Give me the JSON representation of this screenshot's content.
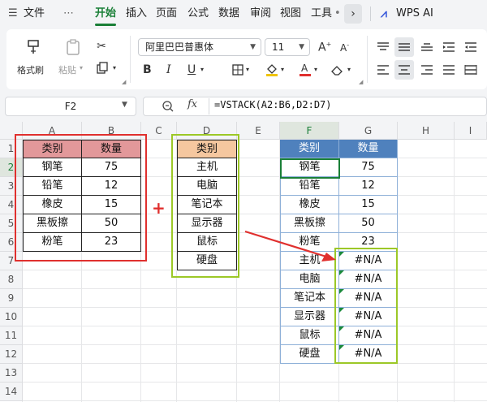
{
  "menu": {
    "file": "文件",
    "more": "⋯",
    "tabs": [
      "开始",
      "插入",
      "页面",
      "公式",
      "数据",
      "审阅",
      "视图",
      "工具"
    ],
    "active_tab": "开始",
    "wps_ai": "WPS AI"
  },
  "ribbon": {
    "format_painter": "格式刷",
    "paste": "粘贴",
    "font_name": "阿里巴巴普惠体",
    "font_size": "11",
    "bold": "B",
    "italic": "I",
    "underline": "U"
  },
  "formula_bar": {
    "cell_ref": "F2",
    "fx": "fx",
    "formula": "=VSTACK(A2:B6,D2:D7)"
  },
  "columns": [
    "A",
    "B",
    "C",
    "D",
    "E",
    "F",
    "G",
    "H",
    "I"
  ],
  "rows": [
    "1",
    "2",
    "3",
    "4",
    "5",
    "6",
    "7",
    "8",
    "9",
    "10",
    "11",
    "12",
    "13",
    "14"
  ],
  "table1": {
    "headers": [
      "类别",
      "数量"
    ],
    "rows": [
      [
        "钢笔",
        "75"
      ],
      [
        "铅笔",
        "12"
      ],
      [
        "橡皮",
        "15"
      ],
      [
        "黑板擦",
        "50"
      ],
      [
        "粉笔",
        "23"
      ]
    ]
  },
  "table2": {
    "header": "类别",
    "items": [
      "主机",
      "电脑",
      "笔记本",
      "显示器",
      "鼠标",
      "硬盘"
    ]
  },
  "plus_sign": "+",
  "result": {
    "headers": [
      "类别",
      "数量"
    ],
    "rows": [
      [
        "钢笔",
        "75"
      ],
      [
        "铅笔",
        "12"
      ],
      [
        "橡皮",
        "15"
      ],
      [
        "黑板擦",
        "50"
      ],
      [
        "粉笔",
        "23"
      ],
      [
        "主机",
        "#N/A"
      ],
      [
        "电脑",
        "#N/A"
      ],
      [
        "笔记本",
        "#N/A"
      ],
      [
        "显示器",
        "#N/A"
      ],
      [
        "鼠标",
        "#N/A"
      ],
      [
        "硬盘",
        "#N/A"
      ]
    ]
  },
  "colors": {
    "accent_green": "#1a7f37",
    "red_highlight": "#e0302e",
    "green_highlight": "#9cc827",
    "header_red": "#e2989a",
    "header_orange": "#f5c79f",
    "header_blue": "#4f81bd"
  }
}
